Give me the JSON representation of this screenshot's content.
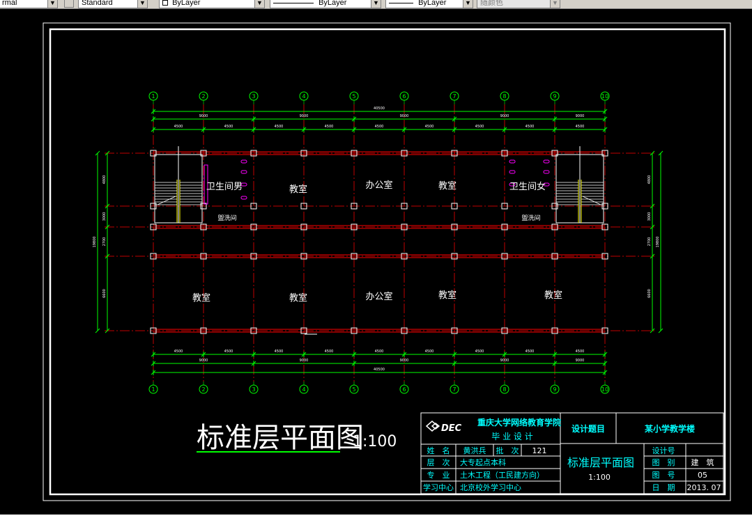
{
  "toolbar": {
    "textstyle_fragment": "rmal",
    "textstyle_value": "Standard",
    "color_value": "ByLayer",
    "linetype_value": "ByLayer",
    "lineweight_value": "ByLayer",
    "plotstyle_value": "随颜色"
  },
  "drawing": {
    "axes": [
      "1",
      "2",
      "3",
      "4",
      "5",
      "6",
      "7",
      "8",
      "9",
      "10"
    ],
    "top_dims": {
      "total": "40500",
      "bays_9000": [
        "9000",
        "9000",
        "9000",
        "9000",
        "9000"
      ],
      "bays_mid": [
        "4500"
      ],
      "bays_4500": [
        "4500",
        "4500",
        "4500",
        "4500",
        "4500",
        "4500",
        "4500",
        "4500",
        "4500"
      ]
    },
    "side_dims_left": [
      "4800",
      "3000",
      "2700",
      "6600"
    ],
    "side_total": "19800",
    "rooms": {
      "toilet_m": "卫生间男",
      "classroom": "教室",
      "office": "办公室",
      "toilet_f": "卫生间女",
      "washroom": "盥洗间"
    },
    "title": "标准层平面图",
    "scale": "1:100"
  },
  "titleblock": {
    "logo": "DEC",
    "school": "重庆大学网络教育学院",
    "project_type": "毕 业 设 计",
    "design_title_label": "设计题目",
    "design_title_value": "某小学教学楼",
    "name_label": "姓　名",
    "name_value": "黄洪兵",
    "batch_label": "批　次",
    "batch_value": "121",
    "level_label": "层　次",
    "level_value": "大专起点本科",
    "major_label": "专　业",
    "major_value": "土木工程（工民建方向）",
    "center_label": "学习中心",
    "center_value": "北京校外学习中心",
    "drawing_name": "标准层平面图",
    "drawing_scale": "1:100",
    "design_no_label": "设计号",
    "category_label": "图　别",
    "category_value": "建　筑",
    "sheet_label": "图　号",
    "sheet_value": "05",
    "date_label": "日　期",
    "date_value": "2013. 07"
  },
  "colors": {
    "axis_line": "#ff0000",
    "grid_line": "#c00000",
    "dimension": "#00ff00",
    "column": "#ffffff",
    "room_text": "#ffffff",
    "tb_text": "#00ffff",
    "tb_cyan": "#00e5ff",
    "fixture": "#ff00ff",
    "frame": "#ffffff",
    "title_underline": "#00ff00"
  }
}
